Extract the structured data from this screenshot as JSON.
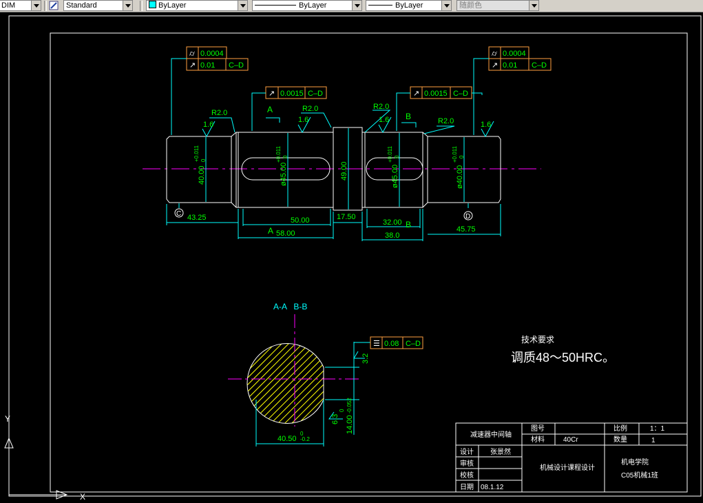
{
  "toolbar": {
    "dimstyle_value": "DIM",
    "textstyle_value": "Standard",
    "color_value": "ByLayer",
    "linetype_value": "ByLayer",
    "lineweight_value": "ByLayer",
    "plotstyle_value": "随颜色"
  },
  "colors": {
    "green": "#00ff00",
    "cyan": "#00ffff",
    "magenta": "#ff00ff",
    "white": "#ffffff",
    "orange": "#ff9f3f",
    "background": "#000000"
  },
  "drawing": {
    "shaft": {
      "tol_top_left": {
        "sym1": "⌭",
        "val1": "0.0004",
        "sym2": "↗",
        "val2": "0.01",
        "datum": "C–D"
      },
      "tol_top_right": {
        "sym1": "⌭",
        "val1": "0.0004",
        "sym2": "↗",
        "val2": "0.01",
        "datum": "C–D"
      },
      "tol_mid_left": {
        "sym": "↗",
        "val": "0.0015",
        "datum": "C–D"
      },
      "tol_mid_right": {
        "sym": "↗",
        "val": "0.0015",
        "datum": "C–D"
      },
      "radius_labels": [
        "R2.0",
        "R2.0",
        "R2.0",
        "R2.0"
      ],
      "roughness_labels": [
        "1.6",
        "1.6",
        "1.6",
        "1.6"
      ],
      "section_label_a": "A",
      "section_label_b": "B",
      "section_label_a2": "A",
      "section_label_b2": "B",
      "diam1": "40.00",
      "diam1_tol_up": "+0.011",
      "diam1_tol_low": "0",
      "diam2": "ø45.00",
      "diam2_tol_up": "+0.011",
      "diam2_tol_low": "0",
      "diam3": "49.00",
      "diam4": "ø45.00",
      "diam4_tol_up": "+0.011",
      "diam4_tol_low": "0",
      "diam5": "ø40.00",
      "diam5_tol_up": "+0.011",
      "diam5_tol_low": "0",
      "datum_c": "C",
      "datum_d": "D",
      "len_43": "43.25",
      "len_50": "50.00",
      "len_58": "58.00",
      "len_17": "17.50",
      "len_32": "32.00",
      "len_38": "38.0",
      "len_45": "45.75"
    },
    "section": {
      "title": "A-A   B-B",
      "tol": {
        "sym": "☰",
        "val": "0.08",
        "datum": "C–D"
      },
      "rough1": "3.2",
      "rough2": "6.3",
      "dim_width": "40.50",
      "dim_width_tol_up": "0",
      "dim_width_tol_low": "-0.2",
      "dim_key": "14.00",
      "dim_key_tol_up": "0",
      "dim_key_tol_low": "-0.052"
    },
    "tech": {
      "heading": "技术要求",
      "text": "调质48～50HRC。"
    },
    "title_block": {
      "name": "减速器中间轴",
      "drawing_no_label": "图号",
      "material_label": "材料",
      "material": "40Cr",
      "scale_label": "比例",
      "scale": "1：1",
      "qty_label": "数量",
      "qty": "1",
      "design_label": "设计",
      "designer": "张景然",
      "review_label": "审核",
      "check_label": "校核",
      "date_label": "日期",
      "date": "08.1.12",
      "course": "机械设计课程设计",
      "school": "机电学院",
      "class_name": "C05机械1班"
    }
  }
}
